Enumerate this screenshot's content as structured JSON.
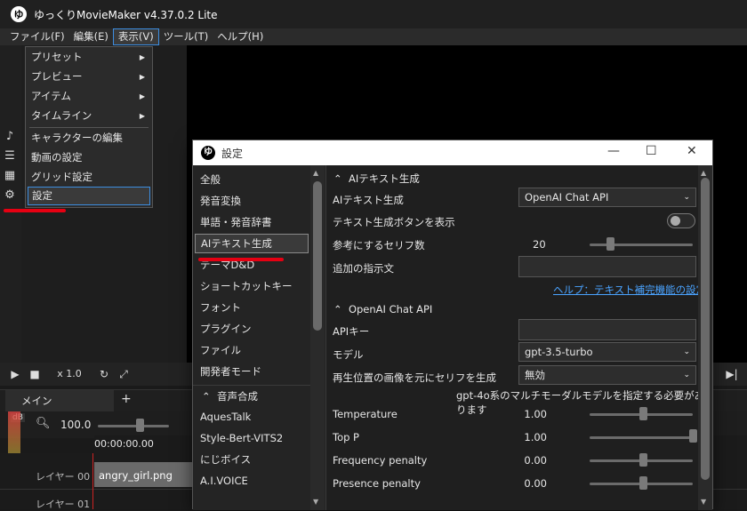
{
  "app": {
    "logo_text": "ゆ",
    "title": "ゆっくりMovieMaker v4.37.0.2 Lite"
  },
  "menubar": [
    "ファイル(F)",
    "編集(E)",
    "表示(V)",
    "ツール(T)",
    "ヘルプ(H)"
  ],
  "view_menu": {
    "items": [
      {
        "label": "プリセット",
        "submenu": true
      },
      {
        "label": "プレビュー",
        "submenu": true
      },
      {
        "label": "アイテム",
        "submenu": true
      },
      {
        "label": "タイムライン",
        "submenu": true
      },
      {
        "label": "キャラクターの編集",
        "submenu": false
      },
      {
        "label": "動画の設定",
        "submenu": false
      },
      {
        "label": "グリッド設定",
        "submenu": false
      },
      {
        "label": "設定",
        "submenu": false,
        "highlighted": true
      }
    ]
  },
  "player": {
    "speed": "x 1.0"
  },
  "timeline": {
    "tab_main": "メイン",
    "tab_add": "+",
    "db_label": "dB",
    "zoom": "100.0",
    "timecode": "00:00:00.00",
    "clip": "angry_girl.png",
    "layer0": "レイヤー 00",
    "layer1": "レイヤー 01"
  },
  "settings": {
    "logo_text": "ゆ",
    "title": "設定",
    "nav": [
      "全般",
      "発音変換",
      "単語・発音辞書",
      "AIテキスト生成",
      "テーマD&D",
      "ショートカットキー",
      "フォント",
      "プラグイン",
      "ファイル",
      "開発者モード"
    ],
    "nav_selected_index": 3,
    "nav_group": "音声合成",
    "nav_group_items": [
      "AquesTalk",
      "Style-Bert-VITS2",
      "にじボイス",
      "A.I.VOICE"
    ],
    "section_ai": "AIテキスト生成",
    "ai_gen_label": "AIテキスト生成",
    "ai_gen_value": "OpenAI Chat API",
    "show_button_label": "テキスト生成ボタンを表示",
    "show_button_on": false,
    "ref_lines_label": "参考にするセリフ数",
    "ref_lines_value": "20",
    "extra_label": "追加の指示文",
    "extra_value": "",
    "help_link": "ヘルプ：テキスト補完機能の設定",
    "section_openai": "OpenAI Chat API",
    "api_key_label": "APIキー",
    "api_key_value": "",
    "model_label": "モデル",
    "model_value": "gpt-3.5-turbo",
    "image_label": "再生位置の画像を元にセリフを生成",
    "image_value": "無効",
    "image_note": "gpt-4o系のマルチモーダルモデルを指定する必要があります",
    "params": [
      {
        "label": "Temperature",
        "value": "1.00",
        "level": 0.5
      },
      {
        "label": "Top P",
        "value": "1.00",
        "level": 1.0
      },
      {
        "label": "Frequency penalty",
        "value": "0.00",
        "level": 0.5
      },
      {
        "label": "Presence penalty",
        "value": "0.00",
        "level": 0.5
      }
    ]
  }
}
